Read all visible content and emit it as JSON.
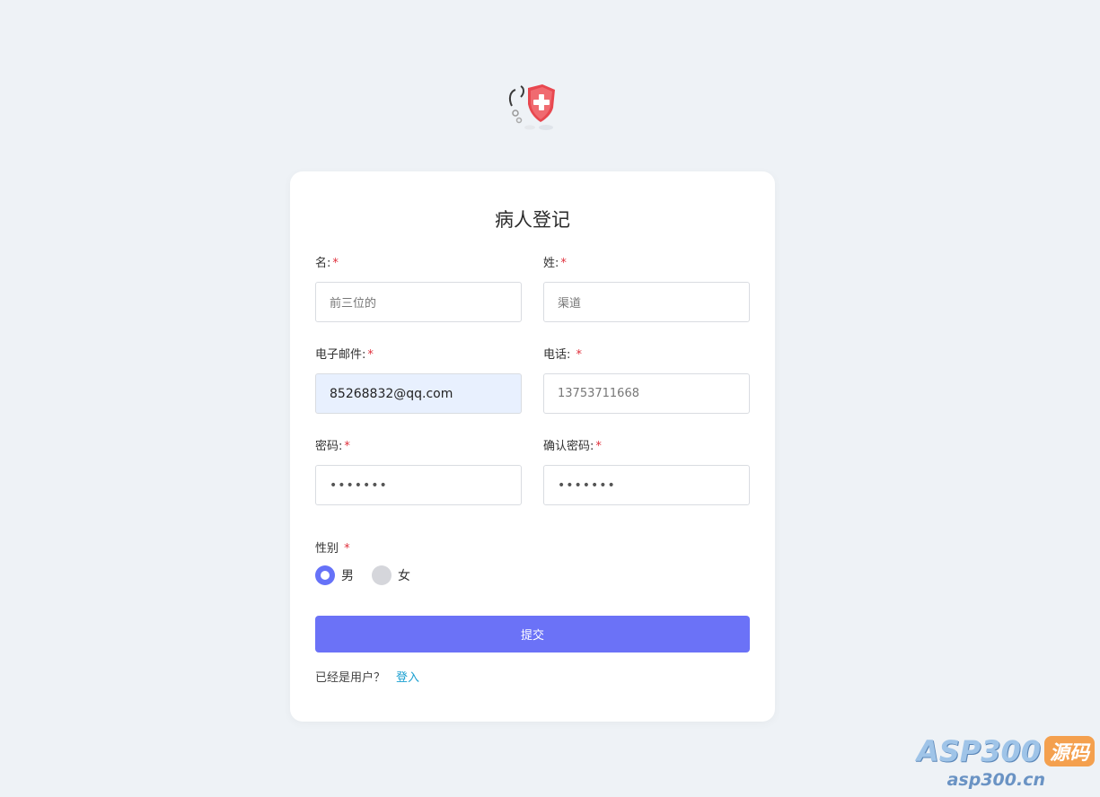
{
  "form": {
    "title": "病人登记",
    "required_mark": "*",
    "fields": {
      "first_name": {
        "label": "名:",
        "placeholder": "前三位的"
      },
      "last_name": {
        "label": "姓:",
        "placeholder": "渠道"
      },
      "email": {
        "label": "电子邮件:",
        "value": "85268832@qq.com"
      },
      "phone": {
        "label": "电话: ",
        "placeholder": "13753711668"
      },
      "password": {
        "label": "密码:",
        "value": "•••••••"
      },
      "confirm_password": {
        "label": "确认密码:",
        "value": "•••••••"
      }
    },
    "gender": {
      "label": "性别 ",
      "options": [
        {
          "label": "男",
          "checked": true
        },
        {
          "label": "女",
          "checked": false
        }
      ]
    },
    "submit_label": "提交",
    "footer": {
      "text": "已经是用户？",
      "link": "登入"
    }
  },
  "watermark": {
    "brand": "ASP300",
    "tag": "源码",
    "url": "asp300.cn"
  },
  "colors": {
    "background": "#eef2f6",
    "accent": "#6b72f7",
    "required": "#e0303c",
    "link": "#1a9fd0",
    "logo_shield": "#e8474f"
  },
  "icons": {
    "logo": "medical-shield-stethoscope-icon"
  }
}
